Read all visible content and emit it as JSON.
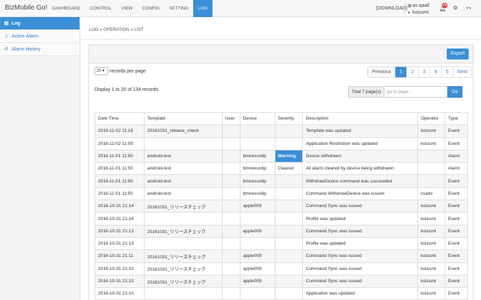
{
  "brand": "BizMobile Go!",
  "nav": [
    "DASHBOARD",
    "CONTROL",
    "VIEW",
    "CONFIG",
    "SETTING",
    "LOG"
  ],
  "nav_active": "LOG",
  "header": {
    "download": "[DOWNLOAD]",
    "tenant": "as-qaall",
    "user": "koizumi",
    "notifications": "24"
  },
  "sidebar": [
    {
      "label": "Log",
      "icon": "document-icon",
      "active": true
    },
    {
      "label": "Active Alarm",
      "icon": "bell-icon",
      "active": false
    },
    {
      "label": "Alarm History",
      "icon": "history-icon",
      "active": false
    }
  ],
  "breadcrumb": "LOG » OPERATION » LIST",
  "export_label": "Export",
  "records_per_page": {
    "value": "20",
    "label": "records per page"
  },
  "pagination": {
    "prev": "Previous",
    "pages": [
      "1",
      "2",
      "3",
      "4",
      "5"
    ],
    "active": "1",
    "next": "Next"
  },
  "display_text": "Display 1 to 20 of 134 records",
  "goto": {
    "total": "Total 7 page(s)",
    "placeholder": "go to page...",
    "go": "Go"
  },
  "table": {
    "columns": [
      "Date Time",
      "Template",
      "User",
      "Device",
      "Severity",
      "Description",
      "Operator",
      "Type"
    ],
    "rows": [
      [
        "2016-11-02 11:16",
        "20161031_release_check",
        "",
        "",
        "",
        "Template was updated",
        "koizumi",
        "Event"
      ],
      [
        "2016-11-02 11:09",
        "",
        "",
        "",
        "",
        "Application Restriction was updated",
        "koizumi",
        "Event"
      ],
      [
        "2016-11-01 11:50",
        "android-test",
        "",
        "bmnexus6p",
        "Warning",
        "Device withdrawn",
        "",
        "Alarm"
      ],
      [
        "2016-11-01 11:50",
        "android-test",
        "",
        "bmnexus6p",
        "Cleared",
        "All alarm cleared by device being withdrawn",
        "",
        "Alarm"
      ],
      [
        "2016-11-01 11:50",
        "android-test",
        "",
        "bmnexus6p",
        "",
        "WithdrawDevice command was succeeded",
        "",
        "Event"
      ],
      [
        "2016-11-01 11:50",
        "android-test",
        "",
        "bmnexus6p",
        "",
        "Command WithdrawDevice was issued",
        "csaito",
        "Event"
      ],
      [
        "2016-10-31 21:14",
        "20161031_リリースチェック",
        "",
        "apple009",
        "",
        "Command Sync was issued",
        "koizumi",
        "Event"
      ],
      [
        "2016-10-31 21:14",
        "",
        "",
        "",
        "",
        "Profile was updated",
        "koizumi",
        "Event"
      ],
      [
        "2016-10-31 21:13",
        "20161031_リリースチェック",
        "",
        "apple009",
        "",
        "Command Sync was issued",
        "koizumi",
        "Event"
      ],
      [
        "2016-10-31 21:13",
        "",
        "",
        "",
        "",
        "Profile was updated",
        "koizumi",
        "Event"
      ],
      [
        "2016-10-31 21:11",
        "20161031_リリースチェック",
        "",
        "apple009",
        "",
        "Command Sync was issued",
        "koizumi",
        "Event"
      ],
      [
        "2016-10-31 21:10",
        "20161031_リリースチェック",
        "",
        "apple009",
        "",
        "Command Sync was issued",
        "koizumi",
        "Event"
      ],
      [
        "2016-10-31 21:10",
        "20161031_リリースチェック",
        "",
        "apple009",
        "",
        "Command Sync was issued",
        "koizumi",
        "Event"
      ],
      [
        "2016-10-31 21:10",
        "",
        "",
        "",
        "",
        "Application was updated",
        "koizumi",
        "Event"
      ]
    ]
  }
}
